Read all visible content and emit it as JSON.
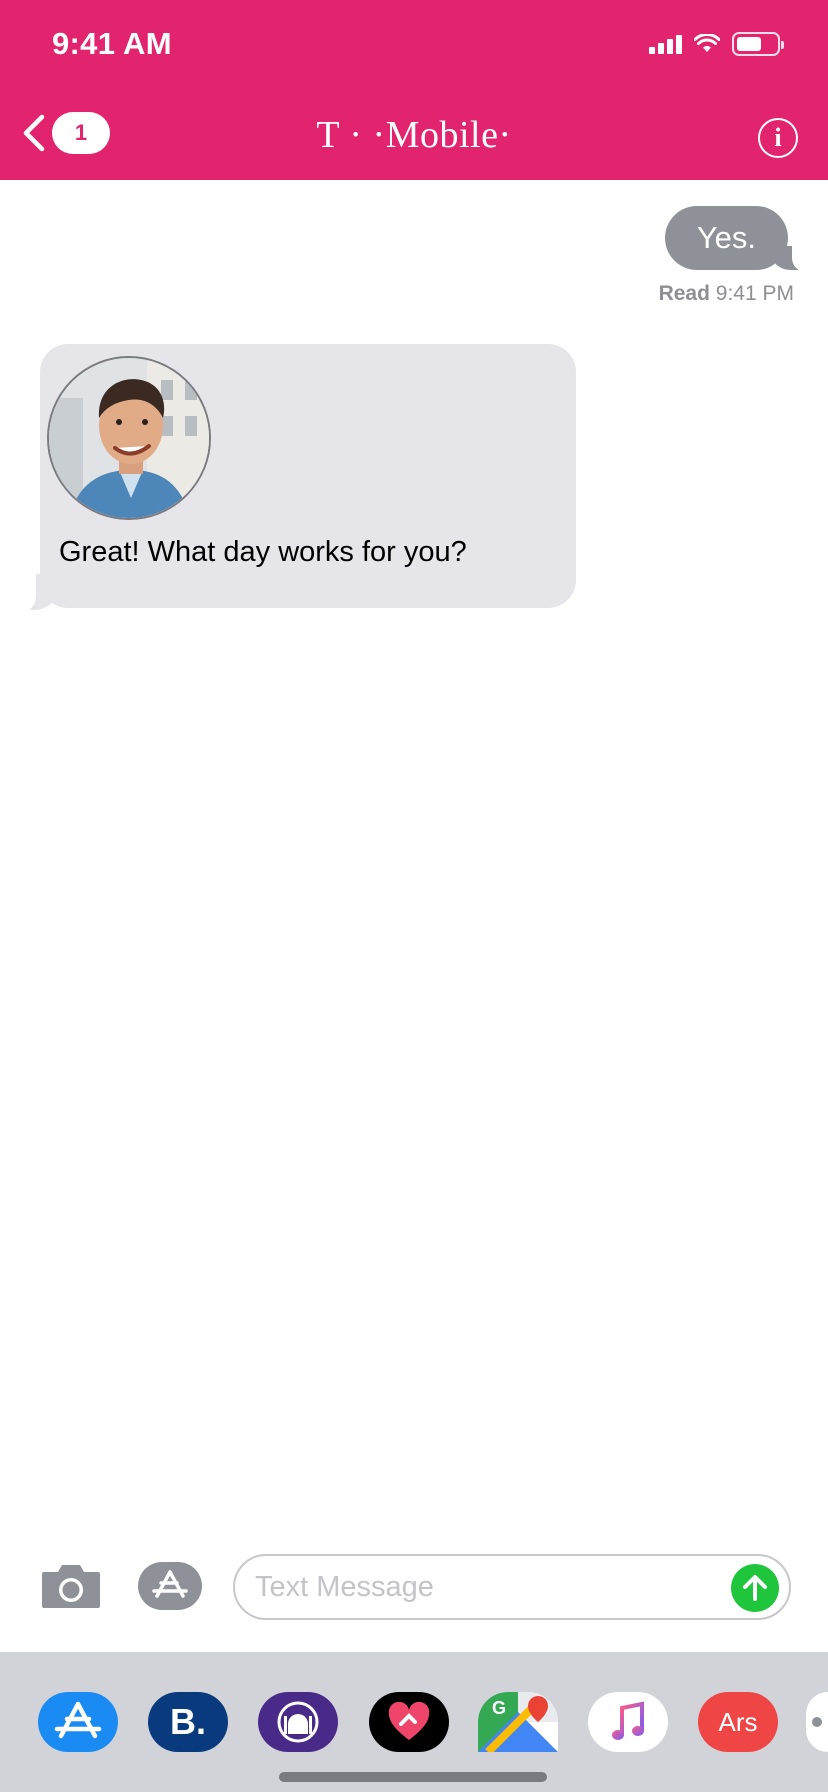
{
  "status_bar": {
    "time": "9:41 AM"
  },
  "nav": {
    "back_badge": "1",
    "carrier_title": "T · ·Mobile·",
    "info_glyph": "i"
  },
  "messages": {
    "sent": {
      "text": "Yes.",
      "receipt_label": "Read",
      "receipt_time": "9:41 PM"
    },
    "received": {
      "text": "Great! What day works for you?"
    }
  },
  "composer": {
    "placeholder": "Text Message"
  },
  "app_drawer": {
    "apps": [
      {
        "name": "app-store",
        "icon": "app-store-icon"
      },
      {
        "name": "booking",
        "icon": "booking-icon",
        "label": "B."
      },
      {
        "name": "mosque",
        "icon": "mosque-icon"
      },
      {
        "name": "heart",
        "icon": "heart-icon"
      },
      {
        "name": "google-maps",
        "icon": "google-maps-icon"
      },
      {
        "name": "music",
        "icon": "music-icon"
      },
      {
        "name": "ars",
        "icon": "ars-icon",
        "label": "Ars"
      }
    ]
  },
  "colors": {
    "header": "#e2246f",
    "sent_bubble": "#8e9298",
    "received_bubble": "#e5e5ea",
    "send_button": "#1fc63c",
    "drawer": "#d1d3d9"
  }
}
